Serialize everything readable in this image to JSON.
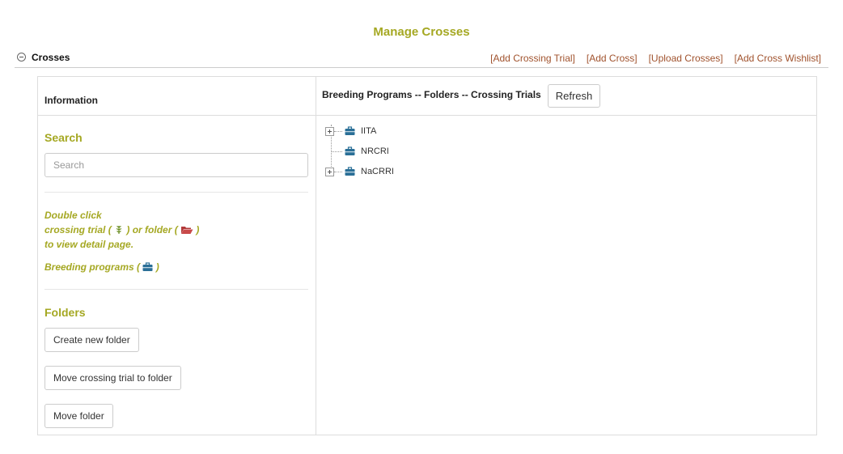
{
  "page": {
    "title": "Manage Crosses"
  },
  "section": {
    "title": "Crosses",
    "links": [
      "[Add Crossing Trial]",
      "[Add Cross]",
      "[Upload Crosses]",
      "[Add Cross Wishlist]"
    ]
  },
  "left": {
    "header": "Information",
    "search": {
      "heading": "Search",
      "placeholder": "Search"
    },
    "hint": {
      "line1": "Double click",
      "line2_a": "crossing trial (",
      "line2_b": ") or folder (",
      "line2_c": ")",
      "line3": "to view detail page.",
      "line4_a": "Breeding programs (",
      "line4_b": ")"
    },
    "folders": {
      "heading": "Folders",
      "create": "Create new folder",
      "move_trial": "Move crossing trial to folder",
      "move_folder": "Move folder"
    }
  },
  "right": {
    "header": "Breeding Programs -- Folders -- Crossing Trials",
    "refresh": "Refresh",
    "tree": [
      {
        "label": "IITA",
        "expandable": true
      },
      {
        "label": "NRCRI",
        "expandable": false
      },
      {
        "label": "NaCRRI",
        "expandable": true
      }
    ]
  },
  "colors": {
    "accent": "#a5a823",
    "link": "#a0522d",
    "program_icon": "#2a6f97",
    "folder_icon": "#b23a3a"
  }
}
